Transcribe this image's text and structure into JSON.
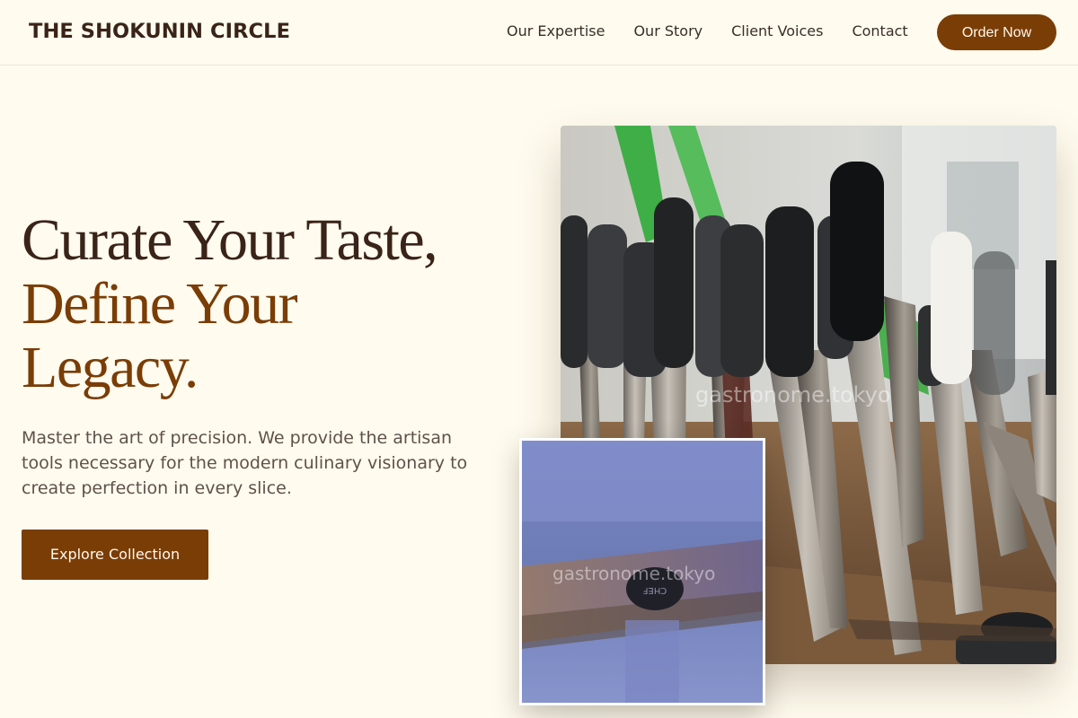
{
  "header": {
    "brand": "THE SHOKUNIN CIRCLE",
    "nav": [
      "Our Expertise",
      "Our Story",
      "Client Voices",
      "Contact"
    ],
    "cta": "Order Now"
  },
  "hero": {
    "headline_line1": "Curate Your Taste,",
    "headline_line2": "Define Your",
    "headline_line3": "Legacy.",
    "subtext": "Master the art of precision. We provide the artisan tools necessary for the modern culinary visionary to create perfection in every slice.",
    "button": "Explore Collection"
  },
  "images": {
    "main_watermark": "gastronome.tokyo",
    "inset_watermark": "gastronome.tokyo",
    "inset_handle_text": "CHEF"
  },
  "colors": {
    "background": "#fffbee",
    "brand_dark": "#3a2318",
    "accent": "#7a3d06"
  }
}
